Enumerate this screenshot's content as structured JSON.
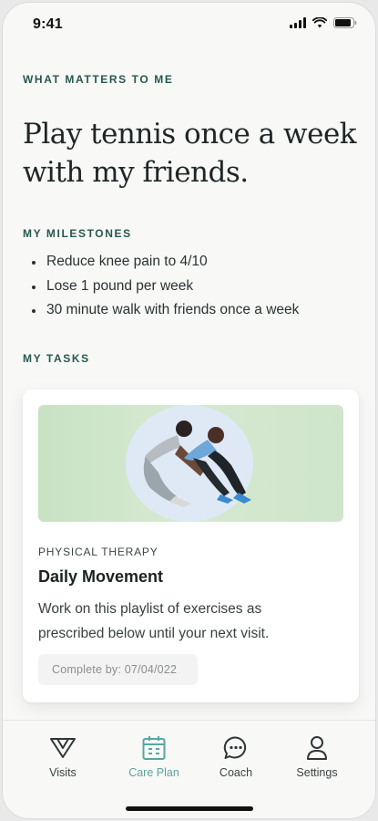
{
  "status_bar": {
    "time": "9:41"
  },
  "what_matters": {
    "label": "WHAT MATTERS TO ME",
    "headline": "Play tennis once a week with my friends."
  },
  "milestones": {
    "label": "MY MILESTONES",
    "items": [
      "Reduce knee pain to 4/10",
      "Lose 1 pound per week",
      "30 minute walk with friends once a week"
    ]
  },
  "tasks": {
    "label": "MY TASKS",
    "card": {
      "category": "PHYSICAL THERAPY",
      "title": "Daily Movement",
      "description": "Work on this playlist of exercises as prescribed below until your next visit.",
      "complete_by": "Complete by: 07/04/022",
      "image": "two-people-stretching-photo"
    }
  },
  "tab_bar": {
    "active": "care-plan",
    "tabs": [
      {
        "label": "Visits",
        "icon": "visits-logo-icon"
      },
      {
        "label": "Care Plan",
        "icon": "calendar-icon"
      },
      {
        "label": "Coach",
        "icon": "chat-bubble-icon"
      },
      {
        "label": "Settings",
        "icon": "person-icon"
      }
    ]
  },
  "colors": {
    "section_label": "#27584e",
    "active_tab": "#5aa5a1",
    "hero_green": "#cfe5cb",
    "hero_circle": "#dfe9f6"
  }
}
